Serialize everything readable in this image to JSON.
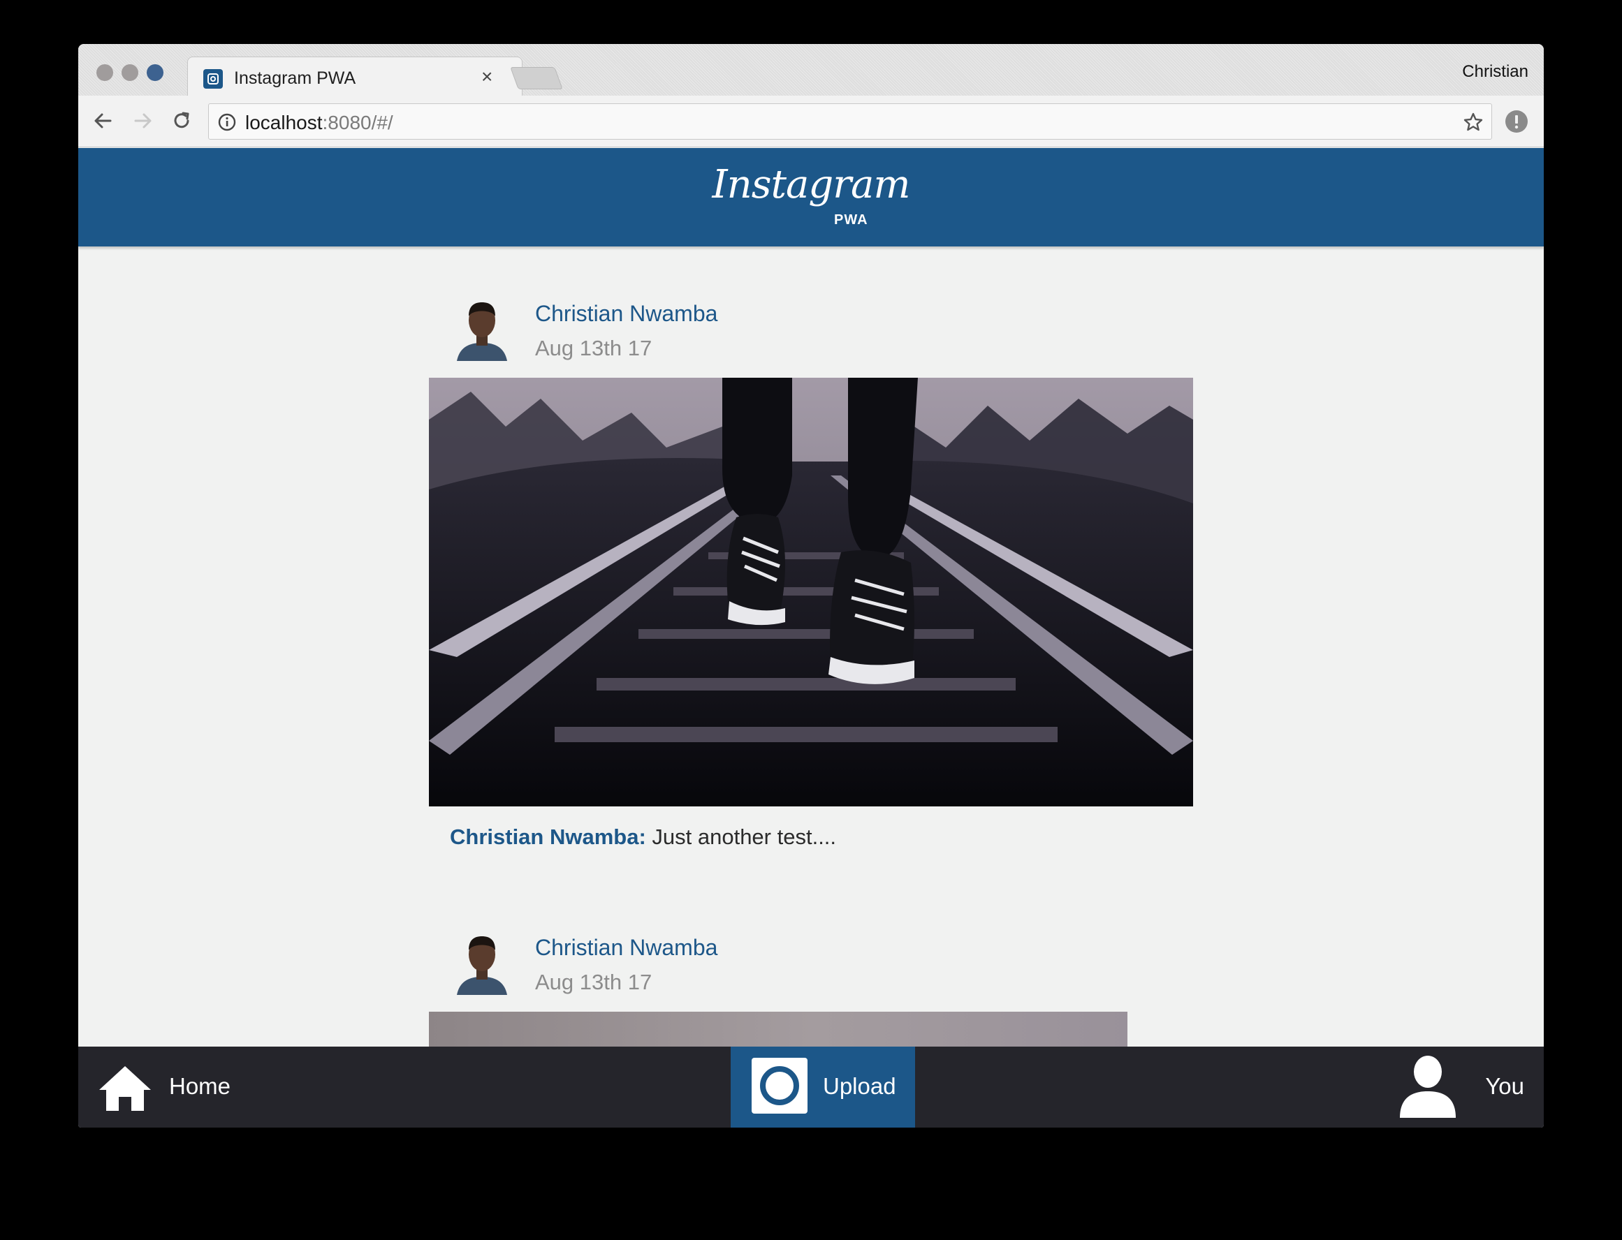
{
  "browser": {
    "tab_title": "Instagram PWA",
    "profile_name": "Christian",
    "url_host": "localhost",
    "url_rest": ":8080/#/"
  },
  "app": {
    "logo_script": "Instagram",
    "logo_sub": "PWA",
    "brand_color": "#1c5789"
  },
  "posts": [
    {
      "author": "Christian Nwamba",
      "date": "Aug 13th 17",
      "caption_author": "Christian Nwamba:",
      "caption_text": " Just another test...."
    },
    {
      "author": "Christian Nwamba",
      "date": "Aug 13th 17"
    }
  ],
  "bottom_nav": {
    "home_label": "Home",
    "upload_label": "Upload",
    "you_label": "You"
  },
  "icons": [
    "back-arrow-icon",
    "forward-arrow-icon",
    "reload-icon",
    "info-icon",
    "star-icon",
    "alert-icon",
    "home-icon",
    "camera-icon",
    "user-icon"
  ]
}
